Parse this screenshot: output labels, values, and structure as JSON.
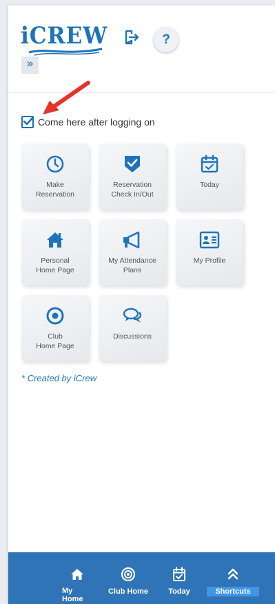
{
  "header": {
    "logo_text": "iCREW",
    "help_label": "?",
    "expand_label": "»"
  },
  "settings": {
    "home_checkbox_label": "Come here after logging on",
    "home_checkbox_checked": true
  },
  "shortcuts": [
    {
      "label": "Make\nReservation",
      "icon": "clock-icon"
    },
    {
      "label": "Reservation\nCheck In/Out",
      "icon": "shield-check-icon"
    },
    {
      "label": "Today",
      "icon": "calendar-check-icon"
    },
    {
      "label": "Personal\nHome Page",
      "icon": "home-icon"
    },
    {
      "label": "My Attendance\nPlans",
      "icon": "megaphone-icon"
    },
    {
      "label": "My Profile",
      "icon": "id-card-icon"
    },
    {
      "label": "Club\nHome Page",
      "icon": "target-icon"
    },
    {
      "label": "Discussions",
      "icon": "chat-bubbles-icon"
    }
  ],
  "footnote": "* Created by iCrew",
  "bottom_nav": [
    {
      "label": "My Home",
      "icon": "home-icon"
    },
    {
      "label": "Club Home",
      "icon": "target-icon"
    },
    {
      "label": "Today",
      "icon": "calendar-check-icon"
    },
    {
      "label": "Shortcuts",
      "icon": "double-chevron-up-icon",
      "active": true
    }
  ],
  "colors": {
    "brand_blue": "#1e74b8",
    "nav_bar": "#2f74b7",
    "nav_active": "#3f95e8",
    "annotation_arrow": "#e5342a"
  }
}
